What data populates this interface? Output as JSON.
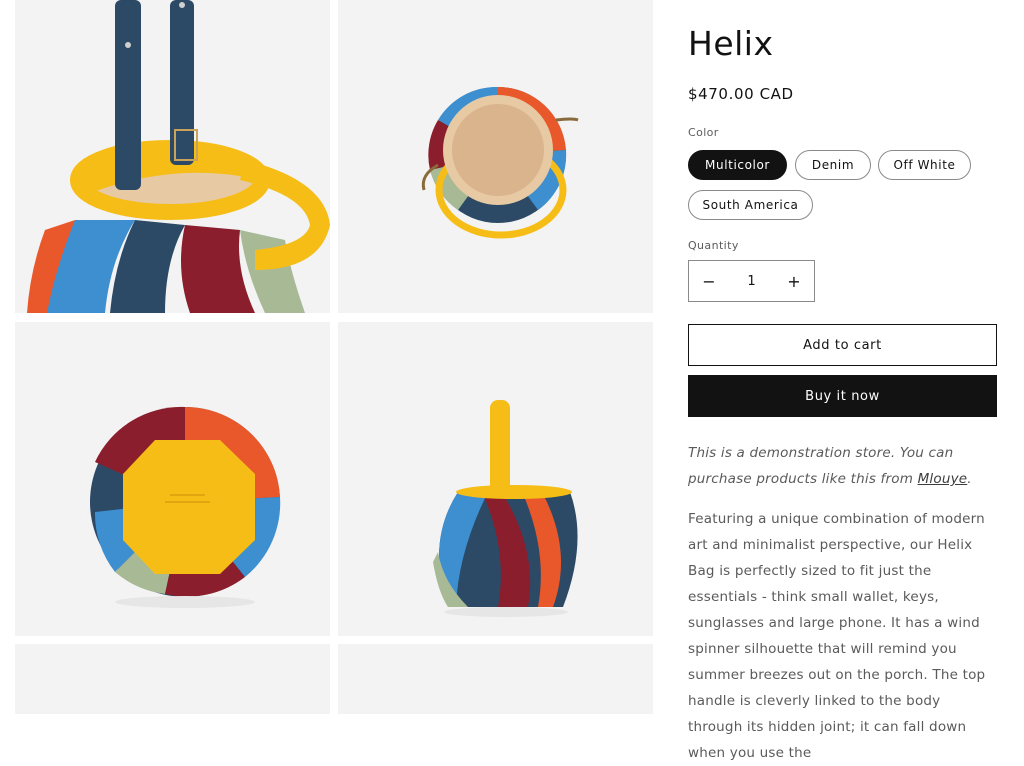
{
  "product": {
    "title": "Helix",
    "price": "$470.00 CAD",
    "color_label": "Color",
    "colors": [
      "Multicolor",
      "Denim",
      "Off White",
      "South America"
    ],
    "selected_color": "Multicolor",
    "quantity_label": "Quantity",
    "quantity": "1",
    "add_to_cart": "Add to cart",
    "buy_now": "Buy it now",
    "note_prefix": "This is a demonstration store. You can purchase products like this from ",
    "note_link": "Mlouye",
    "note_suffix": ".",
    "description": "Featuring a unique combination of modern art and minimalist perspective, our Helix Bag is perfectly sized to fit just the essentials - think small wallet, keys, sunglasses and large phone. It has a wind spinner silhouette that will remind you summer breezes out on the porch. The top handle is cleverly linked to the body through its hidden joint; it can fall down when you use the"
  },
  "icons": {
    "minus": "−",
    "plus": "+"
  },
  "gallery": {
    "images": [
      "helix-bag-handle-closeup",
      "helix-bag-top-view",
      "helix-bag-bottom-view",
      "helix-bag-side-view",
      "helix-bag-image-5",
      "helix-bag-image-6"
    ]
  },
  "palette": {
    "yellow": "#f6bd16",
    "navy": "#2c4a66",
    "blue": "#3d8fd0",
    "red": "#8b1e2c",
    "orange": "#e9582b",
    "sage": "#a8b996",
    "tan": "#e7c9a3",
    "dark": "#121212"
  }
}
